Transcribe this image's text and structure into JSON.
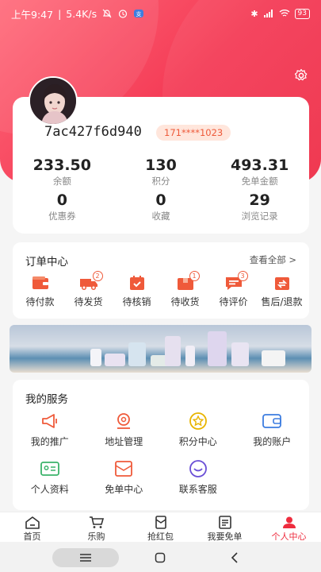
{
  "status_bar": {
    "time": "上午9:47",
    "speed": "5.4K/s",
    "battery": "93"
  },
  "profile": {
    "username": "7ac427f6d940",
    "phone": "171****1023",
    "stats": [
      {
        "value": "233.50",
        "label": "余额"
      },
      {
        "value": "130",
        "label": "积分"
      },
      {
        "value": "493.31",
        "label": "免单金额"
      },
      {
        "value": "0",
        "label": "优惠券"
      },
      {
        "value": "0",
        "label": "收藏"
      },
      {
        "value": "29",
        "label": "浏览记录"
      }
    ]
  },
  "orders": {
    "title": "订单中心",
    "view_all": "查看全部 >",
    "items": [
      {
        "label": "待付款",
        "icon": "wallet-icon",
        "badge": ""
      },
      {
        "label": "待发货",
        "icon": "truck-icon",
        "badge": "2"
      },
      {
        "label": "待核销",
        "icon": "calendar-icon",
        "badge": ""
      },
      {
        "label": "待收货",
        "icon": "box-icon",
        "badge": "1"
      },
      {
        "label": "待评价",
        "icon": "comment-icon",
        "badge": "3"
      },
      {
        "label": "售后/退款",
        "icon": "refund-icon",
        "badge": ""
      }
    ]
  },
  "services": {
    "title": "我的服务",
    "items": [
      {
        "label": "我的推广",
        "icon": "megaphone-icon"
      },
      {
        "label": "地址管理",
        "icon": "location-icon"
      },
      {
        "label": "积分中心",
        "icon": "star-icon"
      },
      {
        "label": "我的账户",
        "icon": "account-icon"
      },
      {
        "label": "个人资料",
        "icon": "id-card-icon"
      },
      {
        "label": "免单中心",
        "icon": "envelope-icon"
      },
      {
        "label": "联系客服",
        "icon": "service-icon"
      }
    ]
  },
  "tabbar": {
    "items": [
      {
        "label": "首页",
        "icon": "home-icon"
      },
      {
        "label": "乐购",
        "icon": "cart-icon"
      },
      {
        "label": "抢红包",
        "icon": "red-packet-icon"
      },
      {
        "label": "我要免单",
        "icon": "note-icon"
      },
      {
        "label": "个人中心",
        "icon": "user-icon"
      }
    ]
  },
  "colors": {
    "accent": "#ee2c3e",
    "orange": "#ef5a3a",
    "gold": "#e8b400",
    "green": "#3bb36a",
    "blue": "#3d7de0",
    "purple": "#6a4fd6"
  }
}
